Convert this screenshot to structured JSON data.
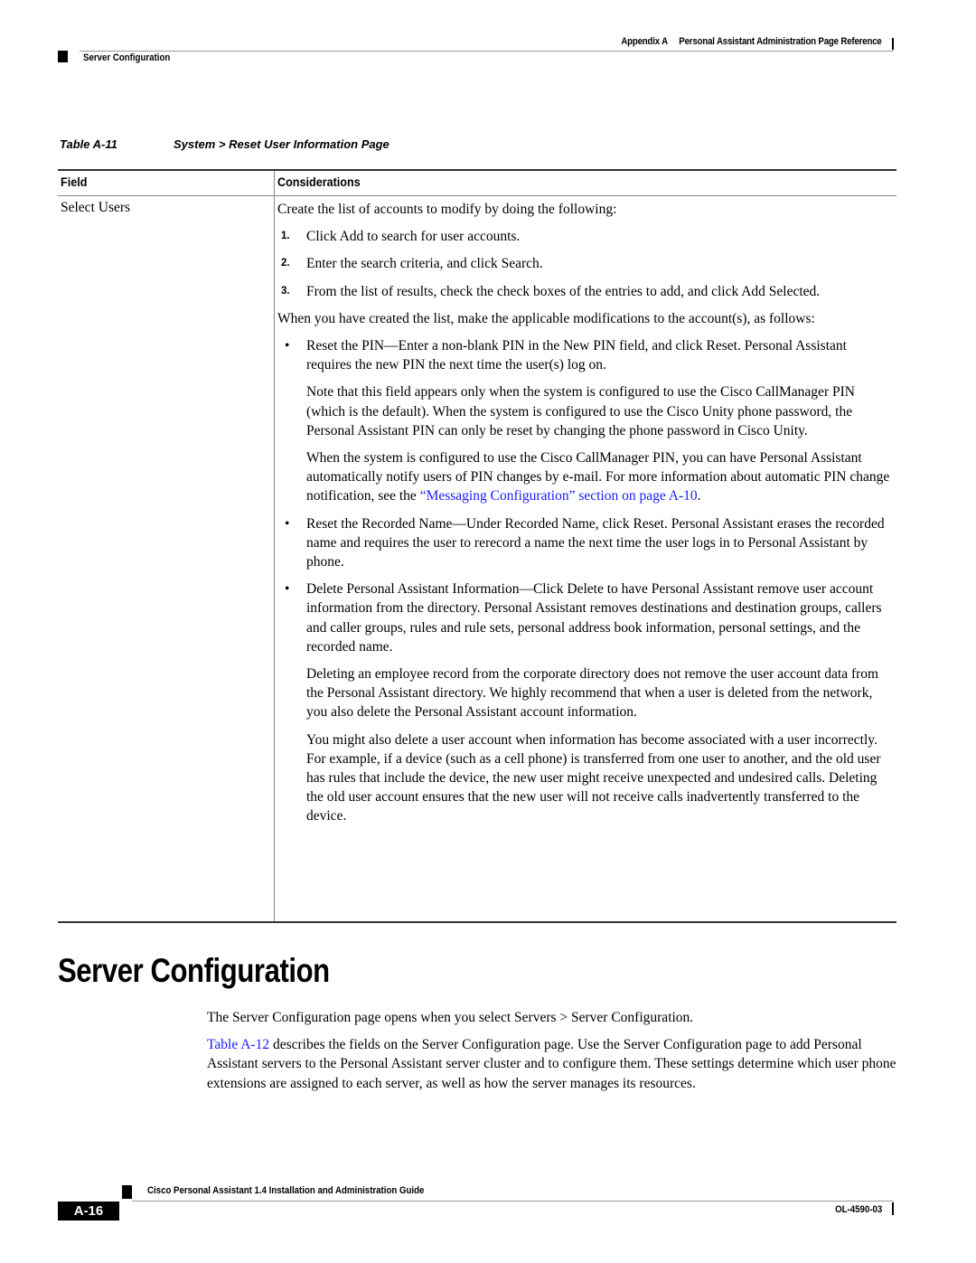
{
  "header": {
    "appendix": "Appendix A",
    "chapter_title": "Personal Assistant Administration Page Reference",
    "section": "Server Configuration"
  },
  "table": {
    "number": "Table A-11",
    "title": "System > Reset User Information Page",
    "columns": [
      "Field",
      "Considerations"
    ],
    "rows": [
      {
        "field": "Select Users",
        "considerations": {
          "intro": "Create the list of accounts to modify by doing the following:",
          "steps": [
            {
              "num": "1.",
              "text": "Click Add to search for user accounts."
            },
            {
              "num": "2.",
              "text": "Enter the search criteria, and click Search."
            },
            {
              "num": "3.",
              "text": "From the list of results, check the check boxes of the entries to add, and click Add Selected."
            }
          ],
          "follow": "When you have created the list, make the applicable modifications to the account(s), as follows:",
          "bullets": [
            {
              "text": "Reset the PIN—Enter a non-blank PIN in the New PIN field, and click Reset. Personal Assistant requires the new PIN the next time the user(s) log on.",
              "notes": [
                "Note that this field appears only when the system is configured to use the Cisco CallManager PIN (which is the default). When the system is configured to use the Cisco Unity phone password, the Personal Assistant PIN can only be reset by changing the phone password in Cisco Unity."
              ],
              "note_with_link": {
                "before": "When the system is configured to use the Cisco CallManager PIN, you can have Personal Assistant automatically notify users of PIN changes by e-mail. For more information about automatic PIN change notification, see the ",
                "link": "“Messaging Configuration” section on page A-10",
                "after": "."
              }
            },
            {
              "text": "Reset the Recorded Name—Under Recorded Name, click Reset. Personal Assistant erases the recorded name and requires the user to rerecord a name the next time the user logs in to Personal Assistant by phone."
            },
            {
              "text": "Delete Personal Assistant Information—Click Delete to have Personal Assistant remove user account information from the directory. Personal Assistant removes destinations and destination groups, callers and caller groups, rules and rule sets, personal address book information, personal settings, and the recorded name.",
              "notes": [
                "Deleting an employee record from the corporate directory does not remove the user account data from the Personal Assistant directory. We highly recommend that when a user is deleted from the network, you also delete the Personal Assistant account information.",
                "You might also delete a user account when information has become associated with a user incorrectly. For example, if a device (such as a cell phone) is transferred from one user to another, and the old user has rules that include the device, the new user might receive unexpected and undesired calls. Deleting the old user account ensures that the new user will not receive calls inadvertently transferred to the device."
              ]
            }
          ]
        }
      }
    ]
  },
  "section": {
    "title": "Server Configuration",
    "para1": "The Server Configuration page opens when you select Servers > Server Configuration.",
    "para2_link": "Table A-12",
    "para2_rest": " describes the fields on the Server Configuration page. Use the Server Configuration page to add Personal Assistant servers to the Personal Assistant server cluster and to configure them. These settings determine which user phone extensions are assigned to each server, as well as how the server manages its resources."
  },
  "footer": {
    "guide_title": "Cisco Personal Assistant 1.4 Installation and Administration Guide",
    "page_number": "A-16",
    "doc_number": "OL-4590-03"
  },
  "colors": {
    "link": "#1a1aff",
    "rule": "#9a9a9a"
  }
}
